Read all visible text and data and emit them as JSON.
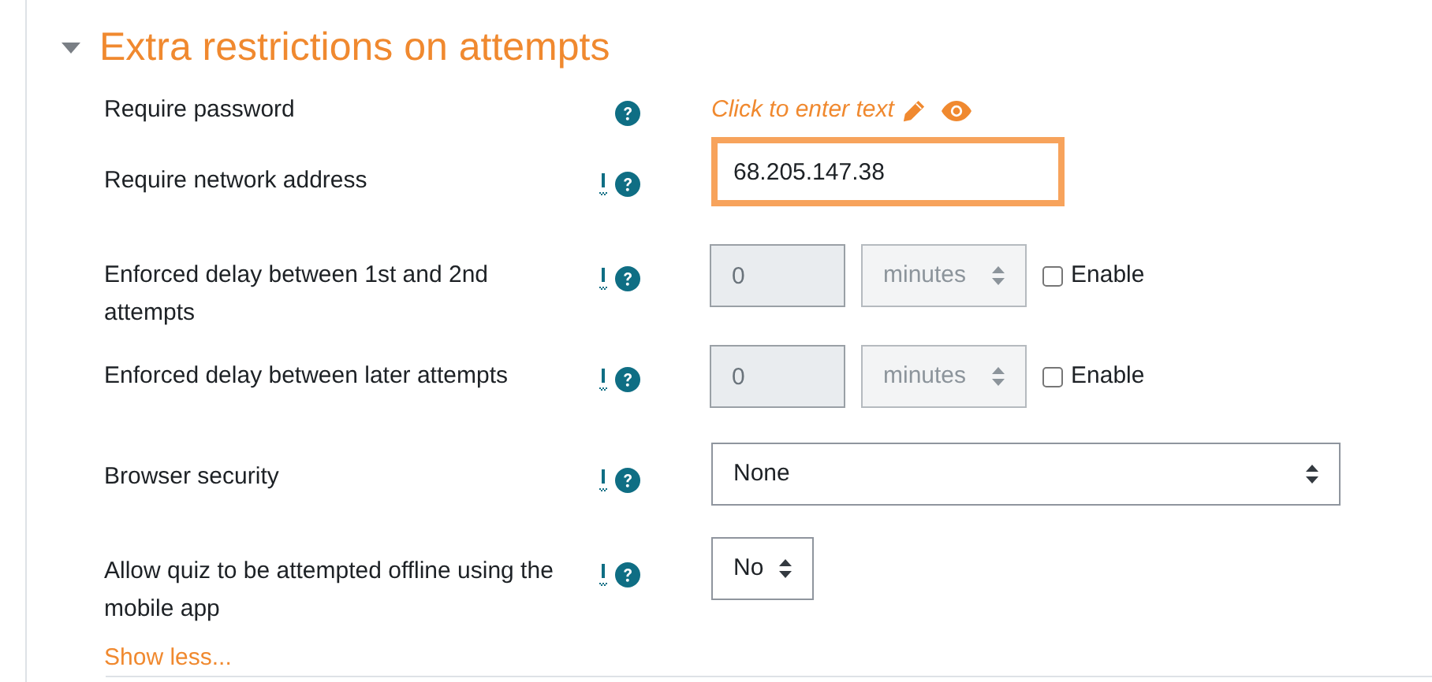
{
  "section": {
    "title": "Extra restrictions on attempts",
    "expanded": true
  },
  "rows": [
    {
      "kind": "inplace",
      "label": "Require password",
      "advanced": false,
      "text": "Click to enter text"
    },
    {
      "kind": "text",
      "label": "Require network address",
      "advanced": true,
      "value": "68.205.147.38",
      "focused": true
    },
    {
      "kind": "duration",
      "label": "Enforced delay between 1st and 2nd attempts",
      "advanced": true,
      "value": "0",
      "unit": "minutes",
      "enable_label": "Enable",
      "enabled": false
    },
    {
      "kind": "duration",
      "label": "Enforced delay between later attempts",
      "advanced": true,
      "value": "0",
      "unit": "minutes",
      "enable_label": "Enable",
      "enabled": false
    },
    {
      "kind": "select",
      "label": "Browser security",
      "advanced": true,
      "value": "None",
      "wide": true
    },
    {
      "kind": "select",
      "label": "Allow quiz to be attempted offline using the mobile app",
      "advanced": true,
      "value": "No",
      "wide": false
    }
  ],
  "show_less": "Show less..."
}
